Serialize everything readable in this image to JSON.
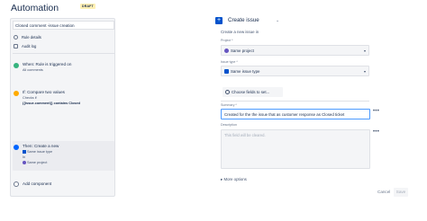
{
  "app": {
    "title": "Automation",
    "badge": "DRAFT"
  },
  "rule": {
    "name": "Closed comment -issue creation",
    "nav": [
      {
        "label": "Rule details",
        "icon": "rule-details-icon"
      },
      {
        "label": "Audit log",
        "icon": "audit-log-icon"
      }
    ],
    "trigger": {
      "title": "When: Rule is triggered on",
      "sub": "All comments"
    },
    "condition": {
      "title": "If: Compare two values",
      "sub1": "Checks if",
      "sub2": "{{issue.comment}} contains Closed"
    },
    "action": {
      "title": "Then: Create a new",
      "type": "Same issue type",
      "word_in": "In",
      "project": "Same project"
    },
    "add_component": "Add component"
  },
  "panel": {
    "title": "Create issue",
    "description": "Create a new issue in",
    "project_label": "Project *",
    "project_value": "Same project",
    "issue_type_label": "Issue type *",
    "issue_type_value": "Same issue type",
    "choose_fields": "Choose fields to set...",
    "summary_label": "Summary *",
    "summary_value": "Created for the the issue that as customer response as Closed ticket",
    "description_label": "Description",
    "description_placeholder": "This field will be cleared.",
    "more_options": "More options",
    "cancel": "Cancel",
    "save": "Save"
  }
}
